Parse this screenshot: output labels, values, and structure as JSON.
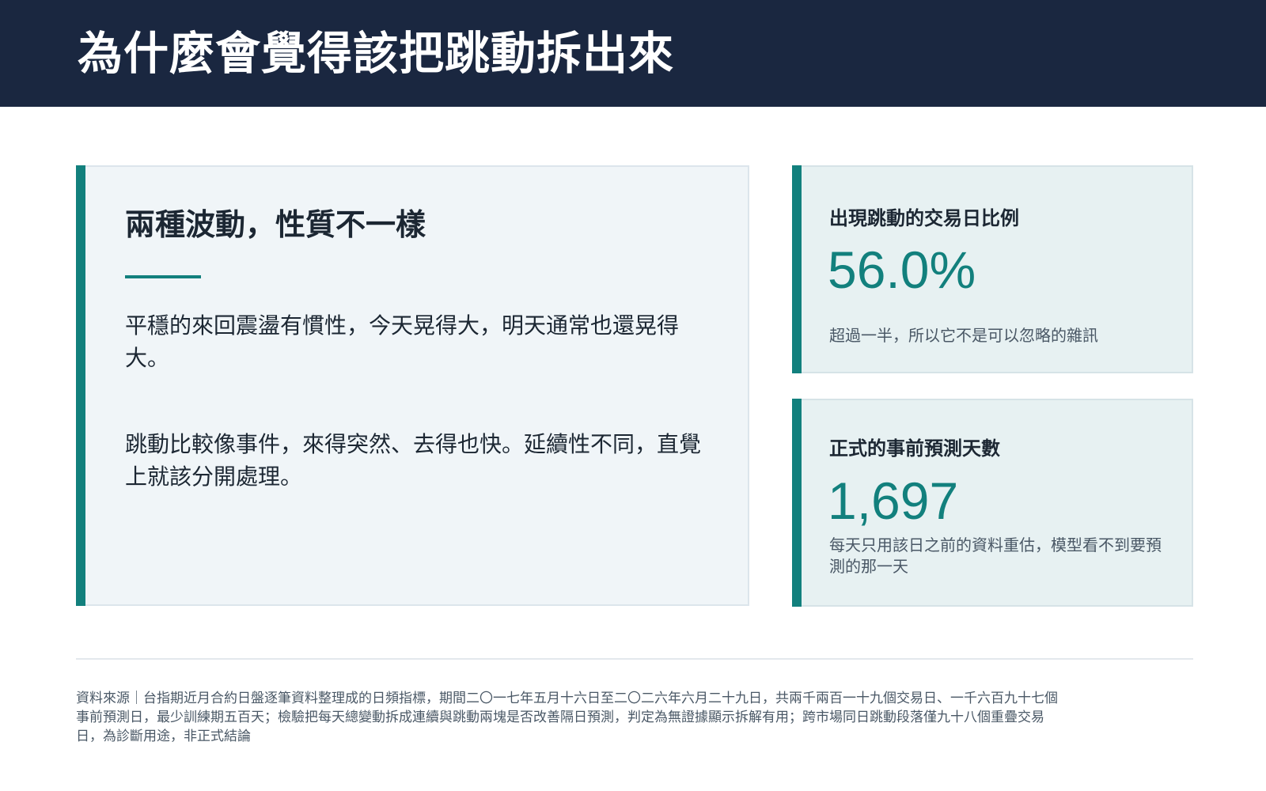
{
  "header": {
    "title": "為什麼會覺得該把跳動拆出來"
  },
  "main_card": {
    "heading": "兩種波動，性質不一樣",
    "paragraphs": [
      "平穩的來回震盪有慣性，今天晃得大，明天通常也還晃得大。",
      "跳動比較像事件，來得突然、去得也快。延續性不同，直覺上就該分開處理。"
    ]
  },
  "stats": [
    {
      "label": "出現跳動的交易日比例",
      "value": "56.0%",
      "note": "超過一半，所以它不是可以忽略的雜訊"
    },
    {
      "label": "正式的事前預測天數",
      "value": "1,697",
      "note": "每天只用該日之前的資料重估，模型看不到要預測的那一天"
    }
  ],
  "footer": {
    "source": "資料來源｜台指期近月合約日盤逐筆資料整理成的日頻指標，期間二〇一七年五月十六日至二〇二六年六月二十九日，共兩千兩百一十九個交易日、一千六百九十七個事前預測日，最少訓練期五百天；檢驗把每天總變動拆成連續與跳動兩塊是否改善隔日預測，判定為無證據顯示拆解有用；跨市場同日跳動段落僅九十八個重疊交易日，為診斷用途，非正式結論"
  },
  "colors": {
    "header_bg": "#1a2740",
    "accent": "#12807d",
    "main_card_bg": "#f0f5f8",
    "stat_card_bg": "#e7f1f2"
  }
}
